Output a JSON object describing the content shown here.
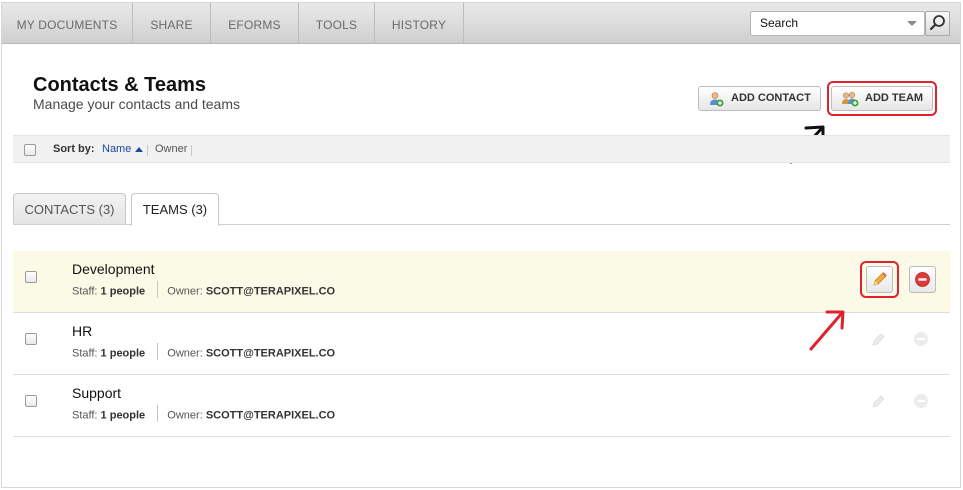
{
  "nav": {
    "items": [
      {
        "label": "MY DOCUMENTS"
      },
      {
        "label": "SHARE"
      },
      {
        "label": "EFORMS"
      },
      {
        "label": "TOOLS"
      },
      {
        "label": "HISTORY"
      }
    ],
    "search": {
      "value": "Search"
    }
  },
  "header": {
    "title": "Contacts & Teams",
    "subtitle": "Manage your contacts and teams",
    "add_contact_label": "ADD CONTACT",
    "add_team_label": "ADD TEAM"
  },
  "sort": {
    "label": "Sort by:",
    "name": "Name",
    "owner": "Owner"
  },
  "tabs": [
    {
      "label": "CONTACTS (3)",
      "active": false
    },
    {
      "label": "TEAMS (3)",
      "active": true
    }
  ],
  "teams": [
    {
      "name": "Development",
      "staff_label": "Staff:",
      "staff": "1 people",
      "owner_label": "Owner:",
      "owner": "SCOTT@TERAPIXEL.CO"
    },
    {
      "name": "HR",
      "staff_label": "Staff:",
      "staff": "1 people",
      "owner_label": "Owner:",
      "owner": "SCOTT@TERAPIXEL.CO"
    },
    {
      "name": "Support",
      "staff_label": "Staff:",
      "staff": "1 people",
      "owner_label": "Owner:",
      "owner": "SCOTT@TERAPIXEL.CO"
    }
  ],
  "colors": {
    "highlight_row": "#fbfae7",
    "annotation_red": "#e0222e",
    "link_blue": "#1a4a9a"
  },
  "icons": [
    "search-icon",
    "add-contact-icon",
    "add-team-icon",
    "sort-asc-icon",
    "pencil-icon",
    "remove-icon",
    "arrow-annotation"
  ]
}
